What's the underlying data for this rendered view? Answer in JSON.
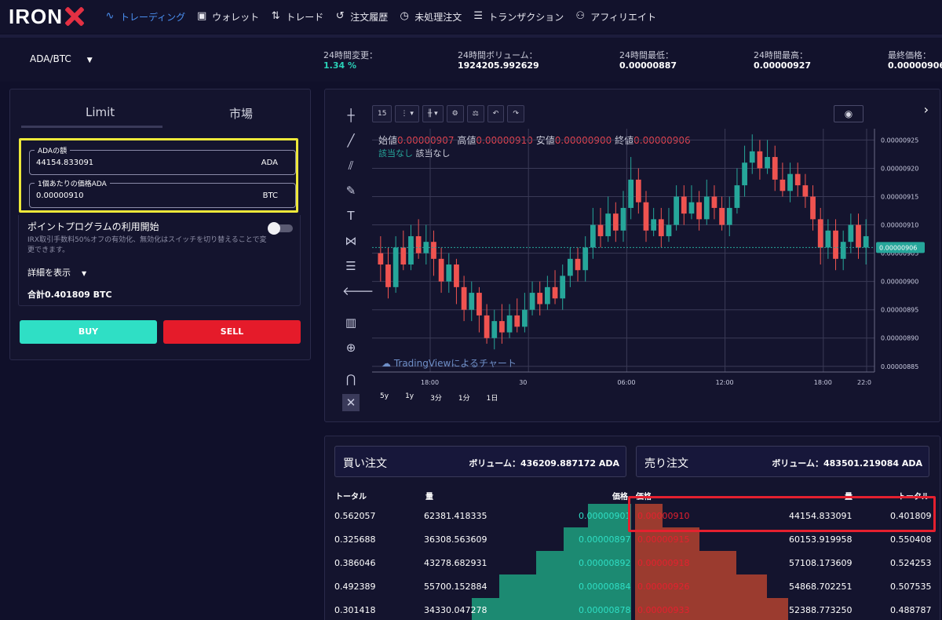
{
  "nav": {
    "logo": "IRON",
    "items": [
      {
        "label": "トレーディング",
        "icon": "chart-wave-icon",
        "active": true
      },
      {
        "label": "ウォレット",
        "icon": "wallet-icon",
        "active": false
      },
      {
        "label": "トレード",
        "icon": "trade-swap-icon",
        "active": false
      },
      {
        "label": "注文履歴",
        "icon": "history-icon",
        "active": false
      },
      {
        "label": "未処理注文",
        "icon": "clock-icon",
        "active": false
      },
      {
        "label": "トランザクション",
        "icon": "list-icon",
        "active": false
      },
      {
        "label": "アフィリエイト",
        "icon": "people-icon",
        "active": false
      }
    ]
  },
  "market": {
    "pair": "ADA/BTC",
    "change_label": "24時間変更：",
    "change_value": "1.34 %",
    "volume_label": "24時間ボリューム：",
    "volume_value": "1924205.992629",
    "low_label": "24時間最低：",
    "low_value": "0.00000887",
    "high_label": "24時間最高：",
    "high_value": "0.00000927",
    "last_label": "最終価格：",
    "last_value": "0.00000906"
  },
  "order_form": {
    "tab_limit": "Limit",
    "tab_market": "市場",
    "amount_legend": "ADAの額",
    "amount_value": "44154.833091",
    "amount_unit": "ADA",
    "price_legend": "1個あたりの価格ADA",
    "price_value": "0.00000910",
    "price_unit": "BTC",
    "program_title": "ポイントプログラムの利用開始",
    "program_desc": "IRX取引手数料50%オフの有効化、無効化はスイッチを切り替えることで変更できます。",
    "details": "詳細を表示",
    "total": "合計0.401809 BTC",
    "buy": "BUY",
    "sell": "SELL"
  },
  "chart": {
    "interval": "15",
    "ohlc": {
      "open_label": "始値",
      "open": "0.00000907",
      "high_label": "高値",
      "high": "0.00000910",
      "low_label": "安値",
      "low": "0.00000900",
      "close_label": "終値",
      "close": "0.00000906"
    },
    "volume_row": {
      "green": "該当なし",
      "white": "該当なし"
    },
    "watermark": "TradingViewによるチャート",
    "ranges": [
      "5y",
      "1y",
      "3分",
      "1分",
      "1日"
    ],
    "price_tag": "0.00000906"
  },
  "chart_data": {
    "type": "candlestick",
    "x_ticks": [
      "18:00",
      "30",
      "06:00",
      "12:00",
      "18:00",
      "22:0"
    ],
    "y_ticks": [
      "0.00000925",
      "0.00000920",
      "0.00000915",
      "0.00000910",
      "0.00000905",
      "0.00000900",
      "0.00000895",
      "0.00000890",
      "0.00000885"
    ],
    "ylim": [
      8.84e-06,
      9.27e-06
    ],
    "last_price": 9.06e-06,
    "candles": [
      [
        905,
        903,
        908,
        900
      ],
      [
        903,
        899,
        906,
        897
      ],
      [
        899,
        906,
        908,
        898
      ],
      [
        906,
        903,
        909,
        902
      ],
      [
        903,
        908,
        910,
        902
      ],
      [
        908,
        905,
        911,
        904
      ],
      [
        905,
        907,
        910,
        903
      ],
      [
        907,
        904,
        909,
        901
      ],
      [
        904,
        900,
        906,
        898
      ],
      [
        900,
        903,
        905,
        898
      ],
      [
        903,
        899,
        904,
        896
      ],
      [
        899,
        895,
        901,
        893
      ],
      [
        895,
        898,
        900,
        893
      ],
      [
        898,
        894,
        899,
        891
      ],
      [
        894,
        890,
        896,
        889
      ],
      [
        890,
        893,
        895,
        888
      ],
      [
        893,
        891,
        896,
        889
      ],
      [
        891,
        894,
        896,
        890
      ],
      [
        894,
        892,
        897,
        891
      ],
      [
        892,
        895,
        898,
        891
      ],
      [
        895,
        898,
        900,
        894
      ],
      [
        898,
        896,
        900,
        894
      ],
      [
        896,
        899,
        901,
        895
      ],
      [
        899,
        897,
        902,
        896
      ],
      [
        897,
        901,
        903,
        895
      ],
      [
        901,
        904,
        906,
        899
      ],
      [
        904,
        902,
        906,
        900
      ],
      [
        902,
        906,
        908,
        900
      ],
      [
        906,
        910,
        913,
        904
      ],
      [
        910,
        908,
        913,
        906
      ],
      [
        908,
        912,
        915,
        907
      ],
      [
        912,
        909,
        914,
        907
      ],
      [
        909,
        913,
        916,
        907
      ],
      [
        913,
        918,
        922,
        911
      ],
      [
        918,
        914,
        920,
        912
      ],
      [
        914,
        909,
        916,
        907
      ],
      [
        909,
        911,
        913,
        908
      ],
      [
        911,
        908,
        913,
        906
      ],
      [
        908,
        910,
        913,
        907
      ],
      [
        910,
        915,
        917,
        909
      ],
      [
        915,
        912,
        917,
        910
      ],
      [
        912,
        914,
        917,
        911
      ],
      [
        914,
        911,
        916,
        909
      ],
      [
        911,
        915,
        918,
        910
      ],
      [
        915,
        913,
        917,
        911
      ],
      [
        913,
        910,
        915,
        909
      ],
      [
        910,
        913,
        915,
        908
      ],
      [
        913,
        917,
        920,
        912
      ],
      [
        917,
        921,
        924,
        915
      ],
      [
        921,
        923,
        926,
        919
      ],
      [
        923,
        920,
        925,
        918
      ],
      [
        920,
        922,
        925,
        919
      ],
      [
        922,
        918,
        924,
        916
      ],
      [
        918,
        916,
        921,
        915
      ],
      [
        916,
        919,
        921,
        914
      ],
      [
        919,
        917,
        921,
        915
      ],
      [
        917,
        915,
        919,
        913
      ],
      [
        915,
        911,
        917,
        909
      ],
      [
        911,
        906,
        913,
        903
      ],
      [
        906,
        909,
        911,
        904
      ],
      [
        909,
        904,
        911,
        902
      ],
      [
        904,
        907,
        909,
        902
      ],
      [
        907,
        910,
        912,
        905
      ],
      [
        910,
        906,
        912,
        904
      ],
      [
        906,
        908,
        911,
        903
      ]
    ]
  },
  "orderbook": {
    "buy_title": "買い注文",
    "buy_volume": "ボリューム：436209.887172 ADA",
    "sell_title": "売り注文",
    "sell_volume": "ボリューム：483501.219084 ADA",
    "buy_headers": {
      "total": "トータル",
      "amount": "量",
      "price": "価格"
    },
    "sell_headers": {
      "price": "価格",
      "amount": "量",
      "total": "トータル"
    },
    "buy_rows": [
      {
        "total": "0.562057",
        "amount": "62381.418335",
        "price": "0.00000901",
        "depth": 0.14
      },
      {
        "total": "0.325688",
        "amount": "36308.563609",
        "price": "0.00000897",
        "depth": 0.22
      },
      {
        "total": "0.386046",
        "amount": "43278.682931",
        "price": "0.00000892",
        "depth": 0.31
      },
      {
        "total": "0.492389",
        "amount": "55700.152884",
        "price": "0.00000884",
        "depth": 0.43
      },
      {
        "total": "0.301418",
        "amount": "34330.047278",
        "price": "0.00000878",
        "depth": 0.52
      }
    ],
    "sell_rows": [
      {
        "price": "0.00000910",
        "amount": "44154.833091",
        "total": "0.401809",
        "depth": 0.09
      },
      {
        "price": "0.00000915",
        "amount": "60153.919958",
        "total": "0.550408",
        "depth": 0.21
      },
      {
        "price": "0.00000918",
        "amount": "57108.173609",
        "total": "0.524253",
        "depth": 0.33
      },
      {
        "price": "0.00000926",
        "amount": "54868.702251",
        "total": "0.507535",
        "depth": 0.43
      },
      {
        "price": "0.00000933",
        "amount": "52388.773250",
        "total": "0.488787",
        "depth": 0.5
      }
    ]
  },
  "colors": {
    "accent": "#2fdfc5",
    "sell": "#e51b2a",
    "highlight_yellow": "#ede83a",
    "highlight_red": "#e5202f"
  }
}
